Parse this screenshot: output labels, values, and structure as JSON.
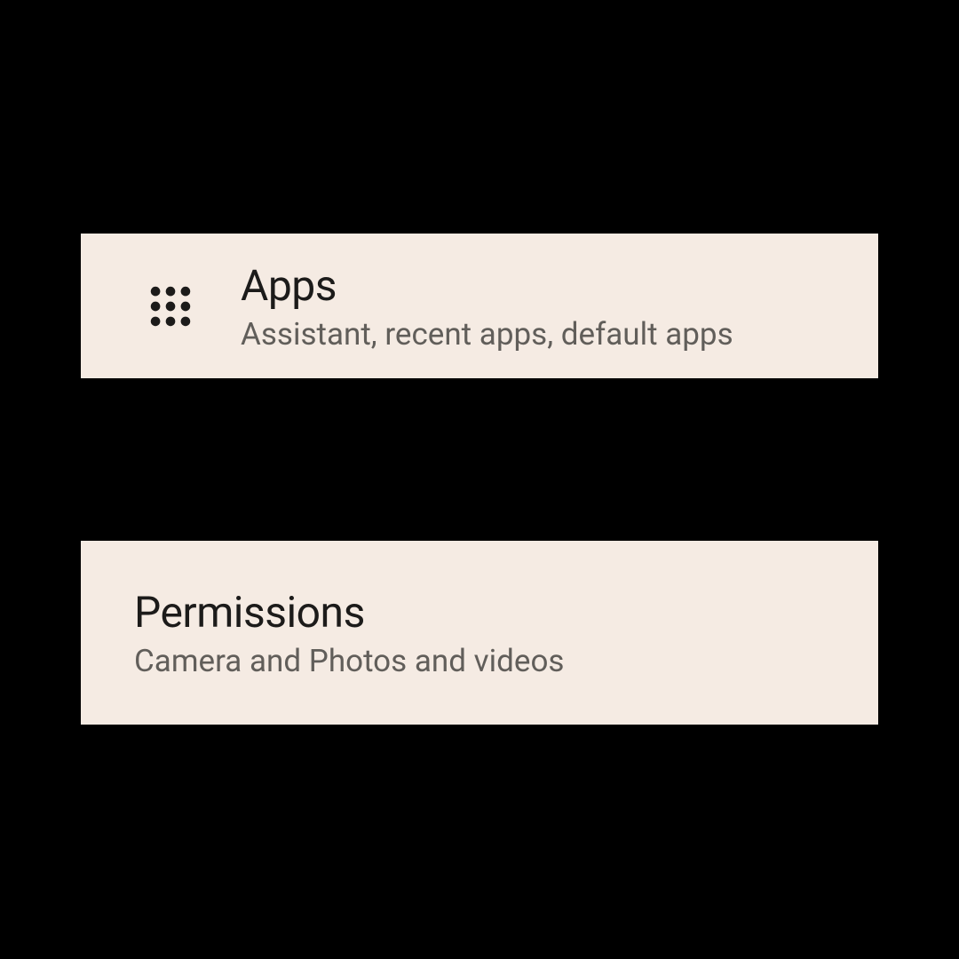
{
  "items": [
    {
      "icon": "apps-grid-icon",
      "title": "Apps",
      "subtitle": "Assistant, recent apps, default apps"
    },
    {
      "title": "Permissions",
      "subtitle": "Camera and Photos and videos"
    }
  ],
  "colors": {
    "background": "#000000",
    "card": "#f5ebe3",
    "title": "#1c1b1a",
    "subtitle": "#615e5a"
  }
}
